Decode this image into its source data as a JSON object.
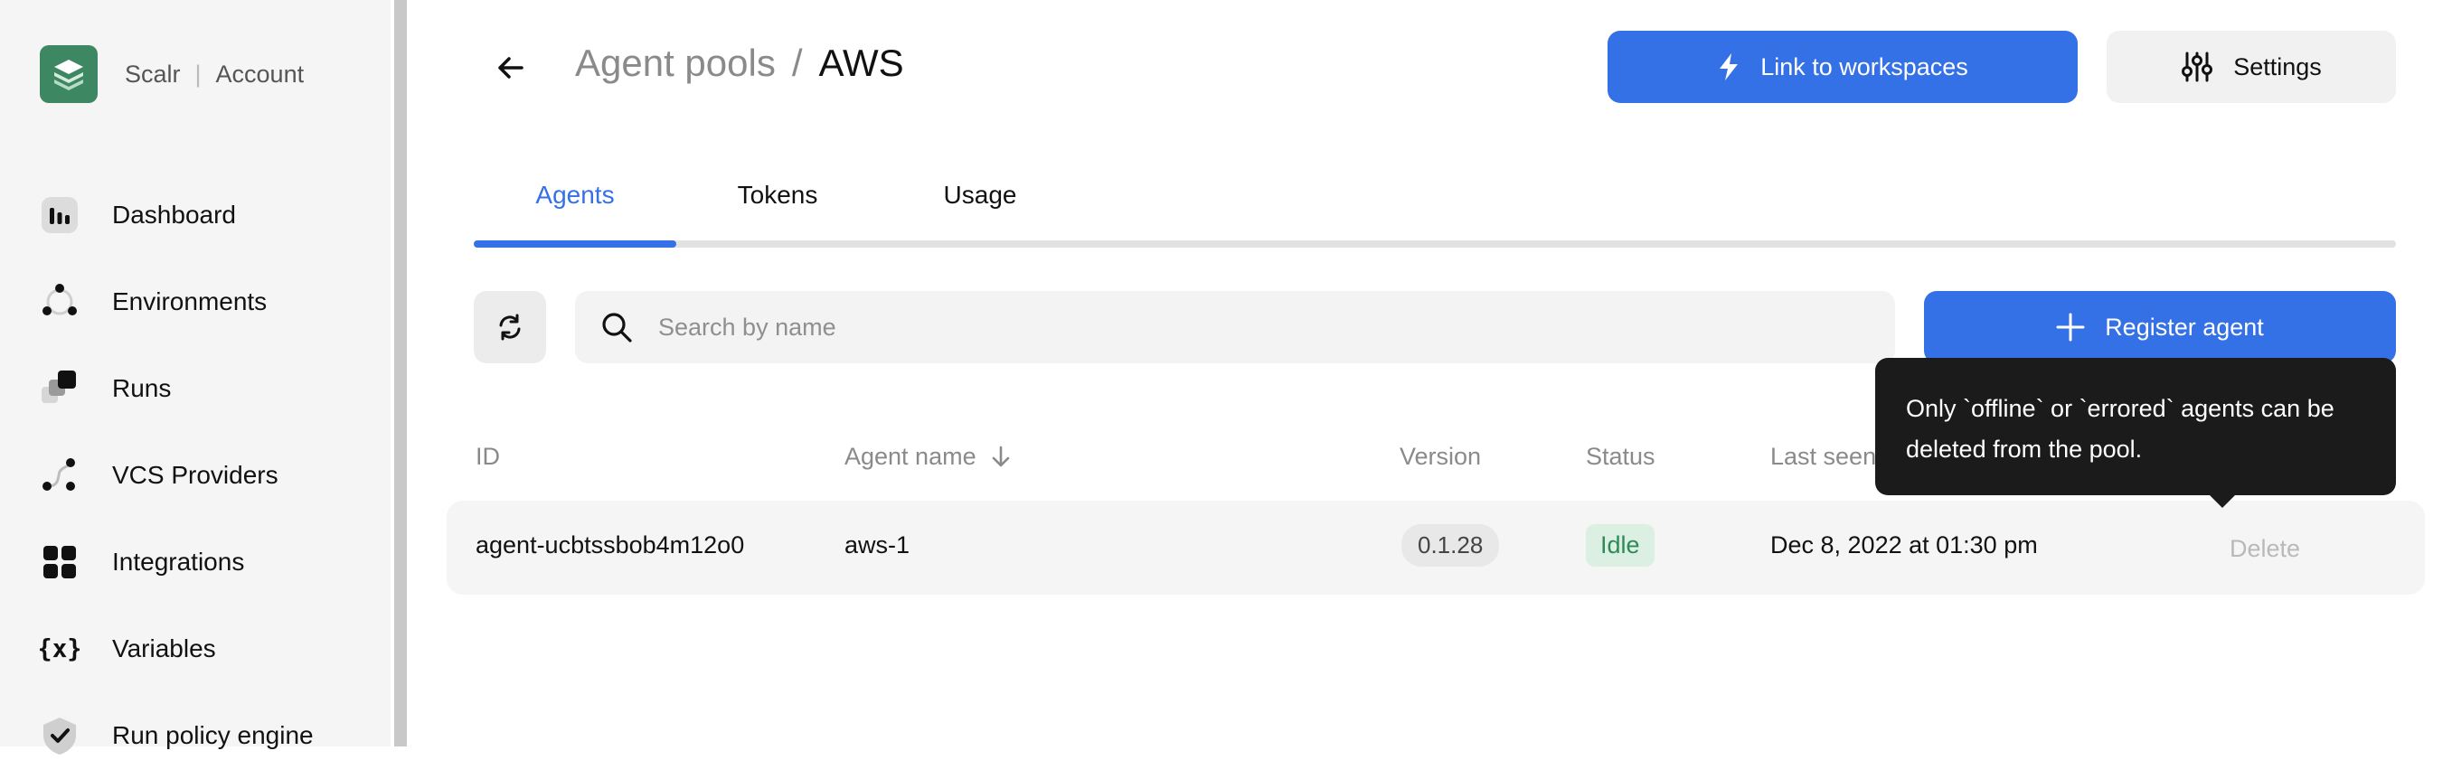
{
  "brand": {
    "name": "Scalr",
    "separator": "|",
    "section": "Account"
  },
  "sidebar": {
    "items": [
      {
        "label": "Dashboard",
        "icon": "dashboard-icon"
      },
      {
        "label": "Environments",
        "icon": "environments-icon"
      },
      {
        "label": "Runs",
        "icon": "runs-icon"
      },
      {
        "label": "VCS Providers",
        "icon": "vcs-providers-icon"
      },
      {
        "label": "Integrations",
        "icon": "integrations-icon"
      },
      {
        "label": "Variables",
        "icon": "variables-icon"
      },
      {
        "label": "Run policy engine",
        "icon": "shield-check-icon"
      }
    ]
  },
  "header": {
    "breadcrumb_parent": "Agent pools",
    "breadcrumb_sep": "/",
    "breadcrumb_current": "AWS",
    "link_button_label": "Link to workspaces",
    "settings_button_label": "Settings"
  },
  "tabs": [
    {
      "label": "Agents",
      "active": true
    },
    {
      "label": "Tokens",
      "active": false
    },
    {
      "label": "Usage",
      "active": false
    }
  ],
  "toolbar": {
    "search_placeholder": "Search by name",
    "register_label": "Register agent"
  },
  "table": {
    "columns": [
      "ID",
      "Agent name",
      "Version",
      "Status",
      "Last seen"
    ],
    "rows": [
      {
        "id": "agent-ucbtssbob4m12o0",
        "name": "aws-1",
        "version": "0.1.28",
        "status": "Idle",
        "last_seen": "Dec 8, 2022 at 01:30 pm",
        "action": "Delete"
      }
    ]
  },
  "tooltip": {
    "line1": "Only `offline` or `errored` agents can be",
    "line2": "deleted from the pool."
  },
  "colors": {
    "primary": "#3571e6",
    "brand": "#3e8763",
    "status_idle_bg": "#dcefe3",
    "status_idle_text": "#2f8a55"
  }
}
